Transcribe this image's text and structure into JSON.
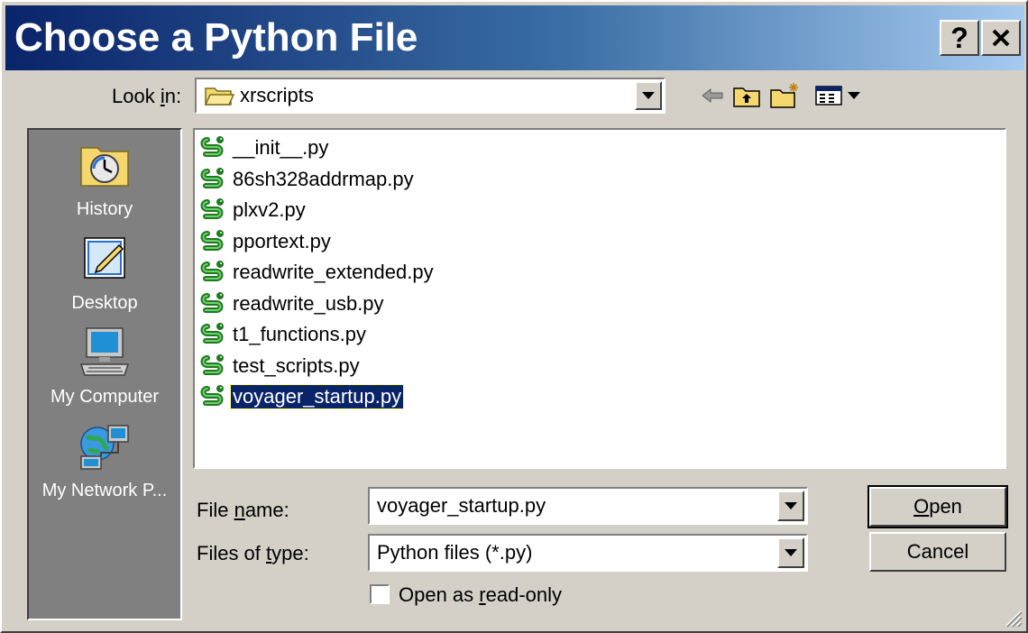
{
  "window": {
    "title": "Choose a Python File",
    "help_button": "?",
    "close_button": "✕"
  },
  "look_in": {
    "label_pre": "Look ",
    "label_access": "i",
    "label_post": "n:",
    "value": "xrscripts"
  },
  "toolbar": {
    "icons": [
      "back-arrow-icon",
      "up-folder-icon",
      "new-folder-icon",
      "view-menu-icon"
    ]
  },
  "places": [
    {
      "label": "History",
      "icon": "history-icon"
    },
    {
      "label": "Desktop",
      "icon": "desktop-icon"
    },
    {
      "label": "My Computer",
      "icon": "my-computer-icon"
    },
    {
      "label": "My Network P...",
      "icon": "my-network-places-icon"
    }
  ],
  "files": [
    {
      "name": "__init__.py",
      "selected": false
    },
    {
      "name": "86sh328addrmap.py",
      "selected": false
    },
    {
      "name": "plxv2.py",
      "selected": false
    },
    {
      "name": "pportext.py",
      "selected": false
    },
    {
      "name": "readwrite_extended.py",
      "selected": false
    },
    {
      "name": "readwrite_usb.py",
      "selected": false
    },
    {
      "name": "t1_functions.py",
      "selected": false
    },
    {
      "name": "test_scripts.py",
      "selected": false
    },
    {
      "name": "voyager_startup.py",
      "selected": true
    }
  ],
  "file_name": {
    "label_pre": "File ",
    "label_access": "n",
    "label_post": "ame:",
    "value": "voyager_startup.py"
  },
  "file_type": {
    "label_pre": "Files of ",
    "label_access": "t",
    "label_post": "ype:",
    "value": "Python files (*.py)"
  },
  "read_only": {
    "label_pre": "Open as ",
    "label_access": "r",
    "label_post": "ead-only",
    "checked": false
  },
  "buttons": {
    "open_access": "O",
    "open_rest": "pen",
    "cancel": "Cancel"
  },
  "colors": {
    "title_bar_start": "#0a246a",
    "title_bar_end": "#a6caf0",
    "selection": "#0a246a",
    "places_bar": "#808080",
    "dialog_face": "#d4d0c8"
  }
}
